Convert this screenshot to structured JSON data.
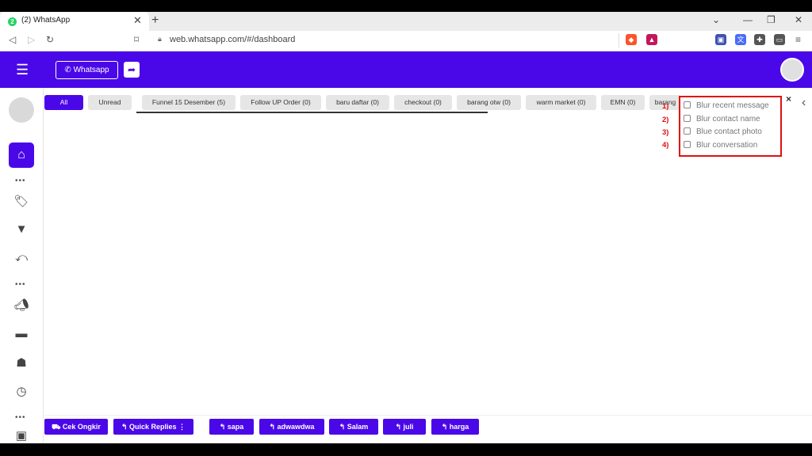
{
  "browser": {
    "tab_title": "(2) WhatsApp",
    "favicon_badge": "2",
    "url": "web.whatsapp.com/#/dashboard"
  },
  "header": {
    "whatsapp_button": "Whatsapp"
  },
  "filters": [
    {
      "label": "All",
      "active": true
    },
    {
      "label": "Unread"
    },
    {
      "label": "Funnel 15 Desember (5)"
    },
    {
      "label": "Follow UP Order (0)"
    },
    {
      "label": "baru daftar (0)"
    },
    {
      "label": "checkout (0)"
    },
    {
      "label": "barang otw (0)"
    },
    {
      "label": "warm market (0)"
    },
    {
      "label": "EMN (0)"
    },
    {
      "label": "barang"
    }
  ],
  "blur_options": {
    "close": "×",
    "items": [
      {
        "num": "1)",
        "label": "Blur recent message"
      },
      {
        "num": "2)",
        "label": "Blur contact name"
      },
      {
        "num": "3)",
        "label": "Blue contact photo"
      },
      {
        "num": "4)",
        "label": "Blur conversation"
      }
    ]
  },
  "quick_buttons": {
    "cek_ongkir": "Cek Ongkir",
    "quick_replies": "Quick Replies",
    "sapa": "sapa",
    "adwawdwa": "adwawdwa",
    "salam": "Salam",
    "juli": "juli",
    "harga": "harga"
  },
  "colors": {
    "brand": "#4a08e8",
    "highlight": "#e01010"
  }
}
